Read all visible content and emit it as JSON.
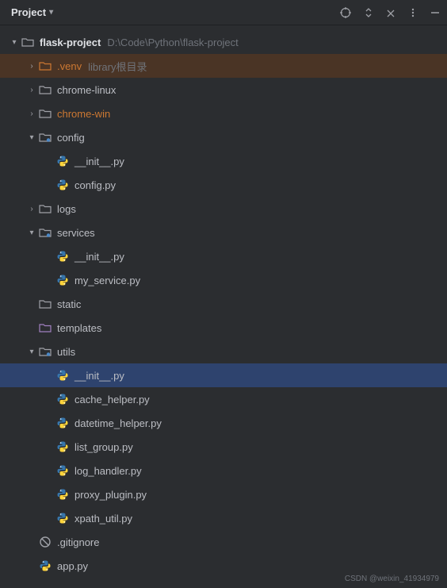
{
  "header": {
    "title": "Project"
  },
  "tree": {
    "root": {
      "name": "flask-project",
      "path": "D:\\Code\\Python\\flask-project"
    },
    "items": [
      {
        "name": ".venv",
        "hint": "library根目录",
        "type": "folder-orange",
        "expand": "collapsed",
        "depth": 1,
        "highlight": "orange"
      },
      {
        "name": "chrome-linux",
        "type": "folder",
        "expand": "collapsed",
        "depth": 1
      },
      {
        "name": "chrome-win",
        "type": "folder",
        "expand": "collapsed",
        "depth": 1,
        "labelColor": "orange"
      },
      {
        "name": "config",
        "type": "folder-src",
        "expand": "expanded",
        "depth": 1
      },
      {
        "name": "__init__.py",
        "type": "python",
        "depth": 2
      },
      {
        "name": "config.py",
        "type": "python",
        "depth": 2
      },
      {
        "name": "logs",
        "type": "folder",
        "expand": "collapsed",
        "depth": 1
      },
      {
        "name": "services",
        "type": "folder-src",
        "expand": "expanded",
        "depth": 1
      },
      {
        "name": "__init__.py",
        "type": "python",
        "depth": 2
      },
      {
        "name": "my_service.py",
        "type": "python",
        "depth": 2
      },
      {
        "name": "static",
        "type": "folder",
        "depth": 1
      },
      {
        "name": "templates",
        "type": "folder-templates",
        "depth": 1
      },
      {
        "name": "utils",
        "type": "folder-src",
        "expand": "expanded",
        "depth": 1
      },
      {
        "name": "__init__.py",
        "type": "python",
        "depth": 2,
        "highlight": "selected"
      },
      {
        "name": "cache_helper.py",
        "type": "python",
        "depth": 2
      },
      {
        "name": "datetime_helper.py",
        "type": "python",
        "depth": 2
      },
      {
        "name": "list_group.py",
        "type": "python",
        "depth": 2
      },
      {
        "name": "log_handler.py",
        "type": "python",
        "depth": 2
      },
      {
        "name": "proxy_plugin.py",
        "type": "python",
        "depth": 2
      },
      {
        "name": "xpath_util.py",
        "type": "python",
        "depth": 2
      },
      {
        "name": ".gitignore",
        "type": "gitignore",
        "depth": 1
      },
      {
        "name": "app.py",
        "type": "python",
        "depth": 1
      }
    ]
  },
  "watermark": "CSDN @weixin_41934979"
}
